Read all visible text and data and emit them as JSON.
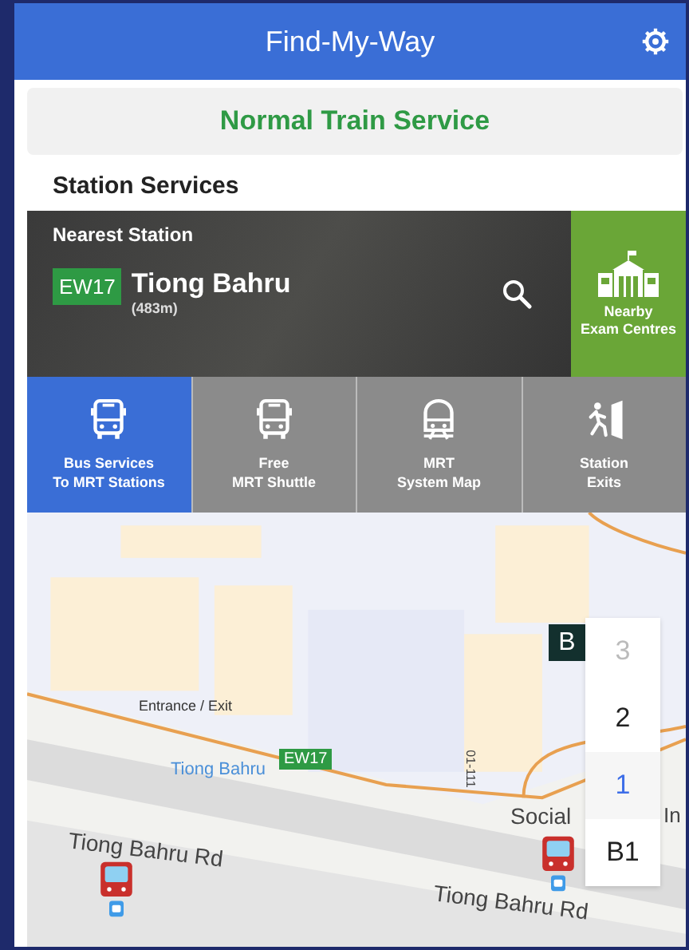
{
  "header": {
    "title": "Find-My-Way"
  },
  "service_status": {
    "text": "Normal Train Service"
  },
  "section_title": "Station Services",
  "nearest_station": {
    "label": "Nearest Station",
    "code": "EW17",
    "name": "Tiong Bahru",
    "distance": "(483m)"
  },
  "nearby_button": {
    "label": "Nearby\nExam Centres"
  },
  "services": [
    {
      "kind": "bus",
      "label": "Bus Services\nTo MRT Stations",
      "selected": true
    },
    {
      "kind": "shuttle",
      "label": "Free\nMRT Shuttle",
      "selected": false
    },
    {
      "kind": "train",
      "label": "MRT\nSystem Map",
      "selected": false
    },
    {
      "kind": "exit",
      "label": "Station\nExits",
      "selected": false
    }
  ],
  "map": {
    "entrance_label": "Entrance / Exit",
    "station_label": "Tiong Bahru",
    "station_code": "EW17",
    "unit_label": "01-111",
    "poi_label": "Social",
    "poi_label_cut": "In",
    "roads": [
      "Tiong Bahru Rd",
      "Tiong Bahru Rd"
    ],
    "building_marker": "B"
  },
  "floors": [
    {
      "label": "3",
      "disabled": true,
      "selected": false
    },
    {
      "label": "2",
      "disabled": false,
      "selected": false
    },
    {
      "label": "1",
      "disabled": false,
      "selected": true
    },
    {
      "label": "B1",
      "disabled": false,
      "selected": false
    }
  ]
}
